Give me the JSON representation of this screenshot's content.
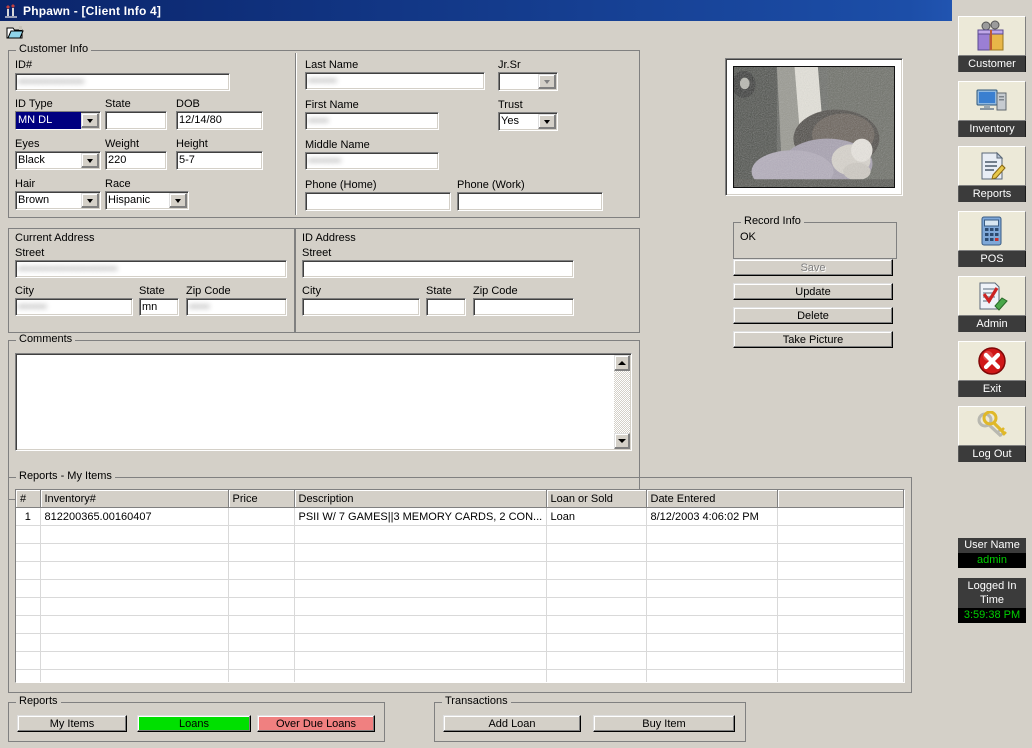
{
  "window": {
    "title": "Phpawn - [Client Info 4]",
    "icon": "app-icon",
    "controls": {
      "minimize": "_",
      "restore": "❐",
      "close": "✕"
    }
  },
  "toolbar": {
    "open_icon": "open-folder-icon"
  },
  "customer_info": {
    "legend": "Customer Info",
    "id_number": {
      "label": "ID#",
      "value": "••••••••••••••••",
      "redacted": true
    },
    "id_type": {
      "label": "ID Type",
      "value": "MN DL",
      "selected": true
    },
    "state": {
      "label": "State",
      "value": ""
    },
    "dob": {
      "label": "DOB",
      "value": "12/14/80"
    },
    "eyes": {
      "label": "Eyes",
      "value": "Black"
    },
    "weight": {
      "label": "Weight",
      "value": "220"
    },
    "height": {
      "label": "Height",
      "value": "5-7"
    },
    "hair": {
      "label": "Hair",
      "value": "Brown"
    },
    "race": {
      "label": "Race",
      "value": "Hispanic"
    },
    "last_name": {
      "label": "Last Name",
      "value": "•••••••",
      "redacted": true
    },
    "jr_sr": {
      "label": "Jr.Sr",
      "value": "",
      "disabled": true
    },
    "first_name": {
      "label": "First Name",
      "value": "•••••",
      "redacted": true
    },
    "trust": {
      "label": "Trust",
      "value": "Yes"
    },
    "middle_name": {
      "label": "Middle Name",
      "value": "••••••••",
      "redacted": true
    },
    "phone_home": {
      "label": "Phone (Home)",
      "value": ""
    },
    "phone_work": {
      "label": "Phone (Work)",
      "value": ""
    }
  },
  "current_address": {
    "legend": "Current Address",
    "street": {
      "label": "Street",
      "value": "••••••••••••••••••••••••",
      "redacted": true
    },
    "city": {
      "label": "City",
      "value": "•••••••",
      "redacted": true
    },
    "state": {
      "label": "State",
      "value": "mn"
    },
    "zip": {
      "label": "Zip Code",
      "value": "•••••",
      "redacted": true
    }
  },
  "id_address": {
    "legend": "ID Address",
    "street": {
      "label": "Street",
      "value": ""
    },
    "city": {
      "label": "City",
      "value": ""
    },
    "state": {
      "label": "State",
      "value": ""
    },
    "zip": {
      "label": "Zip Code",
      "value": ""
    }
  },
  "comments": {
    "legend": "Comments",
    "value": ""
  },
  "record_panel": {
    "record_info_legend": "Record Info",
    "record_info_value": "OK",
    "buttons": [
      {
        "label": "Save",
        "disabled": true
      },
      {
        "label": "Update",
        "disabled": false
      },
      {
        "label": "Delete",
        "disabled": false
      },
      {
        "label": "Take Picture",
        "disabled": false
      }
    ]
  },
  "reports_grid": {
    "legend": "Reports - My Items",
    "columns": [
      "#",
      "Inventory#",
      "Price",
      "Description",
      "Loan or Sold",
      "Date Entered",
      ""
    ],
    "rows": [
      {
        "num": "1",
        "inventory": "812200365.00160407",
        "price": "",
        "description": "PSII W/ 7 GAMES||3 MEMORY CARDS, 2 CON...",
        "loan_or_sold": "Loan",
        "date_entered": "8/12/2003 4:06:02 PM",
        "extra": ""
      }
    ],
    "empty_rows": 9
  },
  "reports_group": {
    "legend": "Reports",
    "buttons": [
      {
        "label": "My Items",
        "color": "#d4d0c8"
      },
      {
        "label": "Loans",
        "color": "#00e000"
      },
      {
        "label": "Over Due Loans",
        "color": "#f08080"
      }
    ]
  },
  "transactions_group": {
    "legend": "Transactions",
    "buttons": [
      {
        "label": "Add Loan"
      },
      {
        "label": "Buy Item"
      }
    ]
  },
  "sidebar": {
    "items": [
      {
        "label": "Customer",
        "icon": "customer-icon"
      },
      {
        "label": "Inventory",
        "icon": "computer-icon"
      },
      {
        "label": "Reports",
        "icon": "document-pencil-icon"
      },
      {
        "label": "POS",
        "icon": "calculator-icon"
      },
      {
        "label": "Admin",
        "icon": "document-check-icon"
      },
      {
        "label": "Exit",
        "icon": "red-x-icon"
      },
      {
        "label": "Log Out",
        "icon": "keys-icon"
      }
    ],
    "user_name_label": "User Name",
    "user_name_value": "admin",
    "logged_in_label": "Logged In Time",
    "logged_in_value": "3:59:38 PM",
    "value_color": "#00d000"
  }
}
